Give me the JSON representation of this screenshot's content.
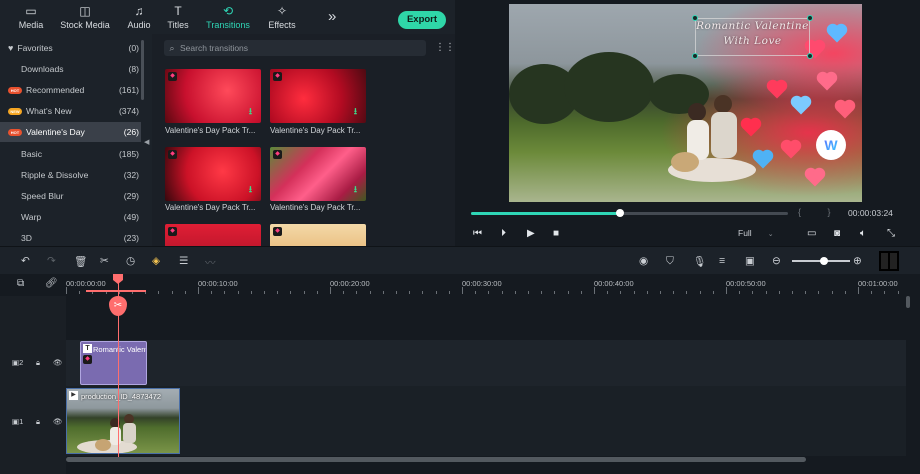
{
  "toolbar": {
    "media": "Media",
    "stock_media": "Stock Media",
    "audio": "Audio",
    "titles": "Titles",
    "transitions": "Transitions",
    "effects": "Effects",
    "export": "Export",
    "more": "»"
  },
  "categories": [
    {
      "icon": "heart",
      "name": "Favorites",
      "count": "(0)"
    },
    {
      "icon": "",
      "name": "Downloads",
      "count": "(8)"
    },
    {
      "icon": "HOT",
      "name": "Recommended",
      "count": "(161)"
    },
    {
      "icon": "NEW",
      "name": "What's New",
      "count": "(374)"
    },
    {
      "icon": "HOT",
      "name": "Valentine's Day",
      "count": "(26)"
    },
    {
      "icon": "",
      "name": "Basic",
      "count": "(185)"
    },
    {
      "icon": "",
      "name": "Ripple & Dissolve",
      "count": "(32)"
    },
    {
      "icon": "",
      "name": "Speed Blur",
      "count": "(29)"
    },
    {
      "icon": "",
      "name": "Warp",
      "count": "(49)"
    },
    {
      "icon": "",
      "name": "3D",
      "count": "(23)"
    }
  ],
  "search": {
    "placeholder": "Search transitions"
  },
  "thumbnails": [
    {
      "name": "Valentine's Day Pack Tr..."
    },
    {
      "name": "Valentine's Day Pack Tr..."
    },
    {
      "name": "Valentine's Day Pack Tr..."
    },
    {
      "name": "Valentine's Day Pack Tr..."
    }
  ],
  "preview": {
    "title_line1": "Romantic Valentine",
    "title_line2": "With Love",
    "timecode": "00:00:03:24",
    "brackets": "{ }",
    "quality": "Full",
    "progress": 0.47
  },
  "timeline": {
    "ruler": [
      "00:00:00:00",
      "00:00:10:00",
      "00:00:20:00",
      "00:00:30:00",
      "00:00:40:00",
      "00:00:50:00",
      "00:01:00:00"
    ],
    "track2_label": "2",
    "track1_label": "1",
    "text_clip": "Romantic Valent",
    "video_clip": "production_ID_4873472",
    "zoom": 0.55
  },
  "colors": {
    "accent": "#2fd6b6",
    "export": "#2fd6a8",
    "playhead": "#ff6e6e"
  }
}
